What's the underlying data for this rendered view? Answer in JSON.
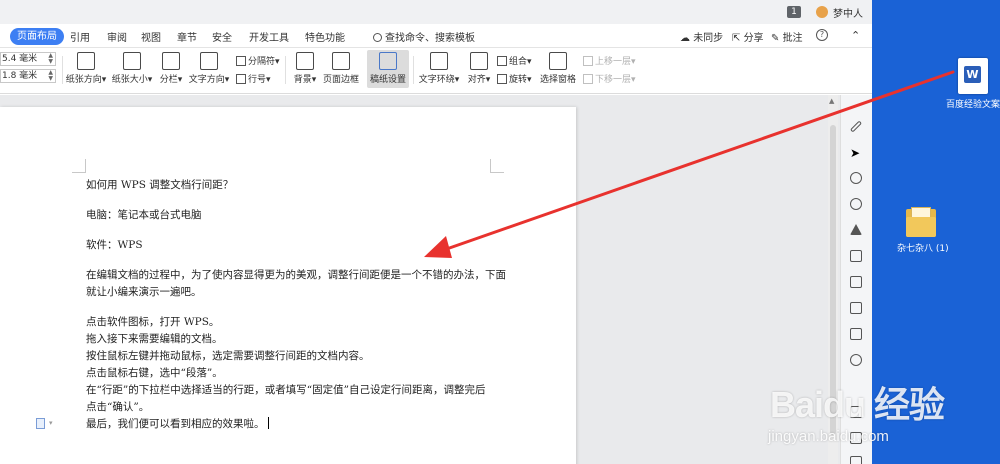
{
  "titlebar": {
    "page_badge": "1",
    "user_name": "梦中人"
  },
  "menu": {
    "active": "页面布局",
    "items": [
      "引用",
      "审阅",
      "视图",
      "章节",
      "安全",
      "开发工具",
      "特色功能"
    ],
    "search": "查找命令、搜索模板",
    "sync": "未同步",
    "share": "分享",
    "comment": "批注",
    "help_icon": "?"
  },
  "ribbon": {
    "margin_top": "5.4 毫米",
    "margin_bottom": "1.8 毫米",
    "orientation": "纸张方向",
    "size": "纸张大小",
    "columns": "分栏",
    "text_direction": "文字方向",
    "separator": "分隔符",
    "line_number": "行号",
    "background": "背景",
    "page_border": "页面边框",
    "grid_settings": "稿纸设置",
    "text_wrap": "文字环绕",
    "align": "对齐",
    "group": "组合",
    "rotate": "旋转",
    "selection_pane": "选择窗格",
    "bring_forward": "上移一层",
    "send_backward": "下移一层"
  },
  "document": {
    "lines": [
      "如何用 WPS 调整文档行间距？",
      "",
      "电脑：笔记本或台式电脑",
      "",
      "软件：WPS",
      "",
      "在编辑文档的过程中，为了使内容显得更为的美观，调整行间距便是一个不错的办法，下面",
      "就让小编来演示一遍吧。",
      "",
      "点击软件图标，打开 WPS。",
      "拖入接下来需要编辑的文档。",
      "按住鼠标左键并拖动鼠标，选定需要调整行间距的文档内容。",
      "点击鼠标右键，选中“段落”。",
      "在“行距”的下拉栏中选择适当的行距，或者填写“固定值”自己设定行间距离，调整完后",
      "点击“确认”。",
      "最后，我们便可以看到相应的效果啦。"
    ]
  },
  "desktop": {
    "doc_file_label": "百度经验文案",
    "doc_file_letter": "W",
    "folder_label": "杂七杂八 (1)"
  },
  "colors": {
    "desktop_bg": "#1a62d6",
    "menu_active_bg": "#3d7ff3",
    "annotation_arrow": "#e8322e"
  },
  "watermark": {
    "logo": "Baidu 经验",
    "url": "jingyan.baidu.com"
  }
}
